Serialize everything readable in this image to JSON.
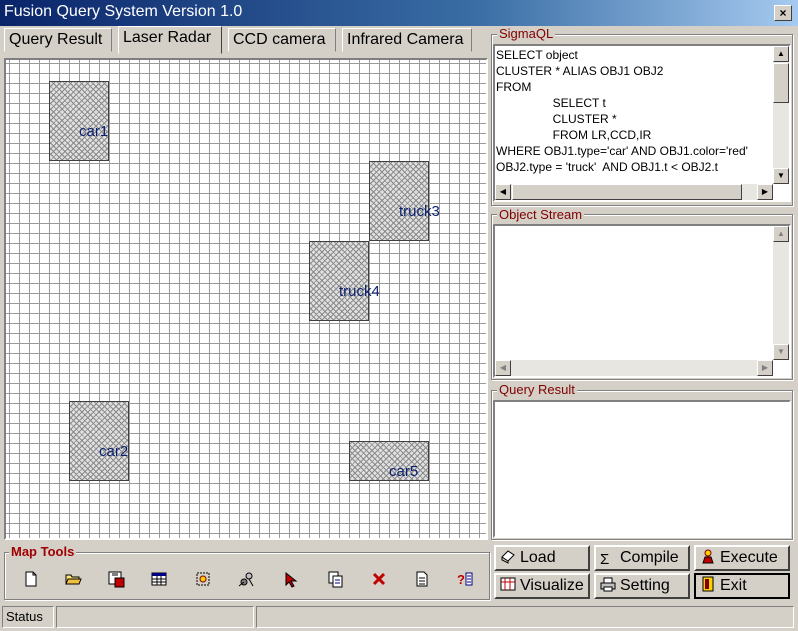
{
  "window": {
    "title": "Fusion Query System Version 1.0",
    "close_label": "×"
  },
  "tabs": [
    {
      "label": "Query Result",
      "active": false
    },
    {
      "label": "Laser Radar",
      "active": true
    },
    {
      "label": "CCD camera",
      "active": false
    },
    {
      "label": "Infrared Camera",
      "active": false
    }
  ],
  "map": {
    "objects": [
      {
        "label": "car1"
      },
      {
        "label": "truck3"
      },
      {
        "label": "truck4"
      },
      {
        "label": "car2"
      },
      {
        "label": "car5"
      }
    ]
  },
  "sigmaql": {
    "label": "SigmaQL",
    "text": "SELECT object\nCLUSTER * ALIAS OBJ1 OBJ2\nFROM\n                 SELECT t\n                 CLUSTER *\n                 FROM LR,CCD,IR\nWHERE OBJ1.type='car' AND OBJ1.color='red'\nOBJ2.type = 'truck'  AND OBJ1.t < OBJ2.t"
  },
  "object_stream": {
    "label": "Object Stream"
  },
  "query_result": {
    "label": "Query Result"
  },
  "map_tools": {
    "label": "Map Tools",
    "icons": [
      "new-file-icon",
      "open-folder-icon",
      "save-icon",
      "table-icon",
      "select-all-icon",
      "query-tool-icon",
      "pointer-icon",
      "copy-icon",
      "delete-icon",
      "document-icon",
      "help-icon"
    ]
  },
  "buttons": {
    "load": "Load",
    "compile": "Compile",
    "execute": "Execute",
    "visualize": "Visualize",
    "setting": "Setting",
    "exit": "Exit"
  },
  "status": {
    "text": "Status"
  },
  "colors": {
    "title_bar": "#0a246a",
    "group_label": "#800000",
    "object_label": "#0a1f6e"
  }
}
